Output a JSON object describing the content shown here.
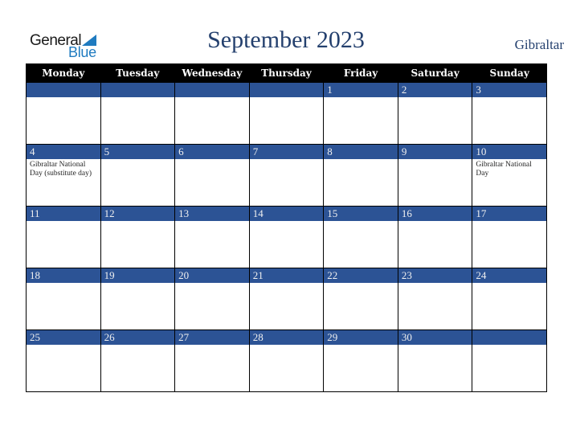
{
  "logo": {
    "general": "General",
    "blue": "Blue",
    "icon": "triangle-flag-icon",
    "brand_color": "#1f7bc0"
  },
  "header": {
    "title": "September 2023",
    "country": "Gibraltar"
  },
  "colors": {
    "title": "#24406e",
    "date_bar": "#2c5395",
    "weekday_header": "#000000"
  },
  "weekdays": [
    "Monday",
    "Tuesday",
    "Wednesday",
    "Thursday",
    "Friday",
    "Saturday",
    "Sunday"
  ],
  "weeks": [
    [
      {
        "day": "",
        "event": ""
      },
      {
        "day": "",
        "event": ""
      },
      {
        "day": "",
        "event": ""
      },
      {
        "day": "",
        "event": ""
      },
      {
        "day": "1",
        "event": ""
      },
      {
        "day": "2",
        "event": ""
      },
      {
        "day": "3",
        "event": ""
      }
    ],
    [
      {
        "day": "4",
        "event": "Gibraltar National Day (substitute day)"
      },
      {
        "day": "5",
        "event": ""
      },
      {
        "day": "6",
        "event": ""
      },
      {
        "day": "7",
        "event": ""
      },
      {
        "day": "8",
        "event": ""
      },
      {
        "day": "9",
        "event": ""
      },
      {
        "day": "10",
        "event": "Gibraltar National Day"
      }
    ],
    [
      {
        "day": "11",
        "event": ""
      },
      {
        "day": "12",
        "event": ""
      },
      {
        "day": "13",
        "event": ""
      },
      {
        "day": "14",
        "event": ""
      },
      {
        "day": "15",
        "event": ""
      },
      {
        "day": "16",
        "event": ""
      },
      {
        "day": "17",
        "event": ""
      }
    ],
    [
      {
        "day": "18",
        "event": ""
      },
      {
        "day": "19",
        "event": ""
      },
      {
        "day": "20",
        "event": ""
      },
      {
        "day": "21",
        "event": ""
      },
      {
        "day": "22",
        "event": ""
      },
      {
        "day": "23",
        "event": ""
      },
      {
        "day": "24",
        "event": ""
      }
    ],
    [
      {
        "day": "25",
        "event": ""
      },
      {
        "day": "26",
        "event": ""
      },
      {
        "day": "27",
        "event": ""
      },
      {
        "day": "28",
        "event": ""
      },
      {
        "day": "29",
        "event": ""
      },
      {
        "day": "30",
        "event": ""
      },
      {
        "day": "",
        "event": ""
      }
    ]
  ]
}
